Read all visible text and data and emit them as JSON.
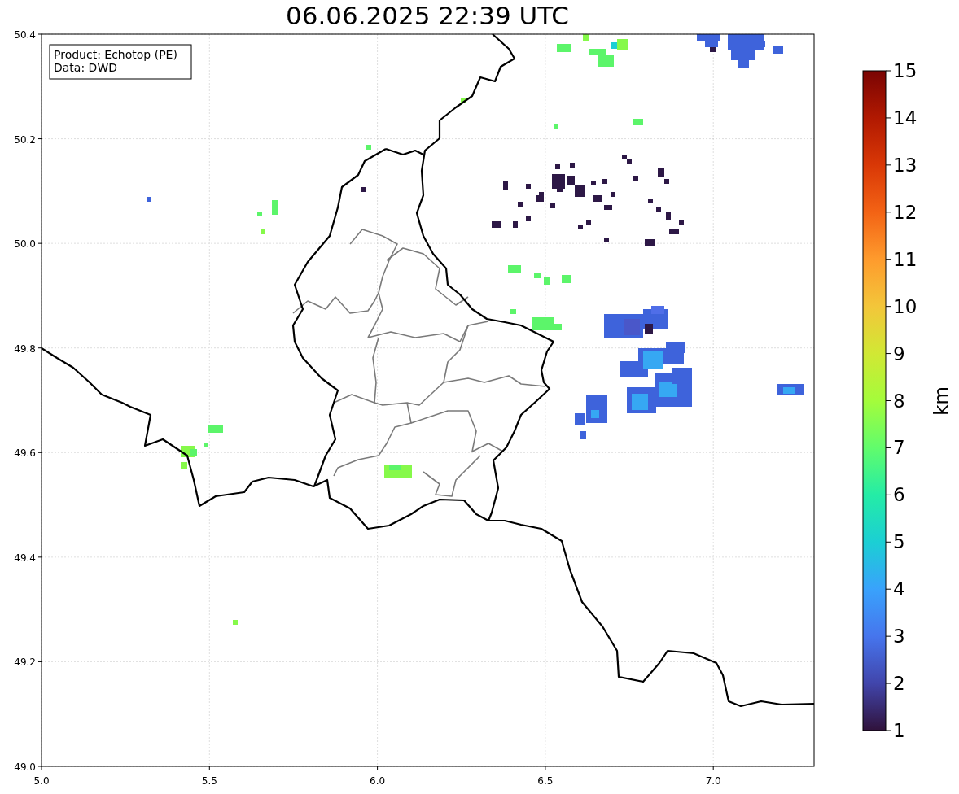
{
  "title": "06.06.2025 22:39 UTC",
  "legend": [
    "Product: Echotop (PE)",
    "Data: DWD"
  ],
  "x_ticks": [
    "5.0",
    "5.5",
    "6.0",
    "6.5",
    "7.0"
  ],
  "y_ticks": [
    "50.4",
    "50.2",
    "50.0",
    "49.8",
    "49.6",
    "49.4",
    "49.2",
    "49.0"
  ],
  "colorbar": {
    "label": "km",
    "ticks": [
      "15",
      "14",
      "13",
      "12",
      "11",
      "10",
      "9",
      "8",
      "7",
      "6",
      "5",
      "4",
      "3",
      "2",
      "1"
    ]
  }
}
